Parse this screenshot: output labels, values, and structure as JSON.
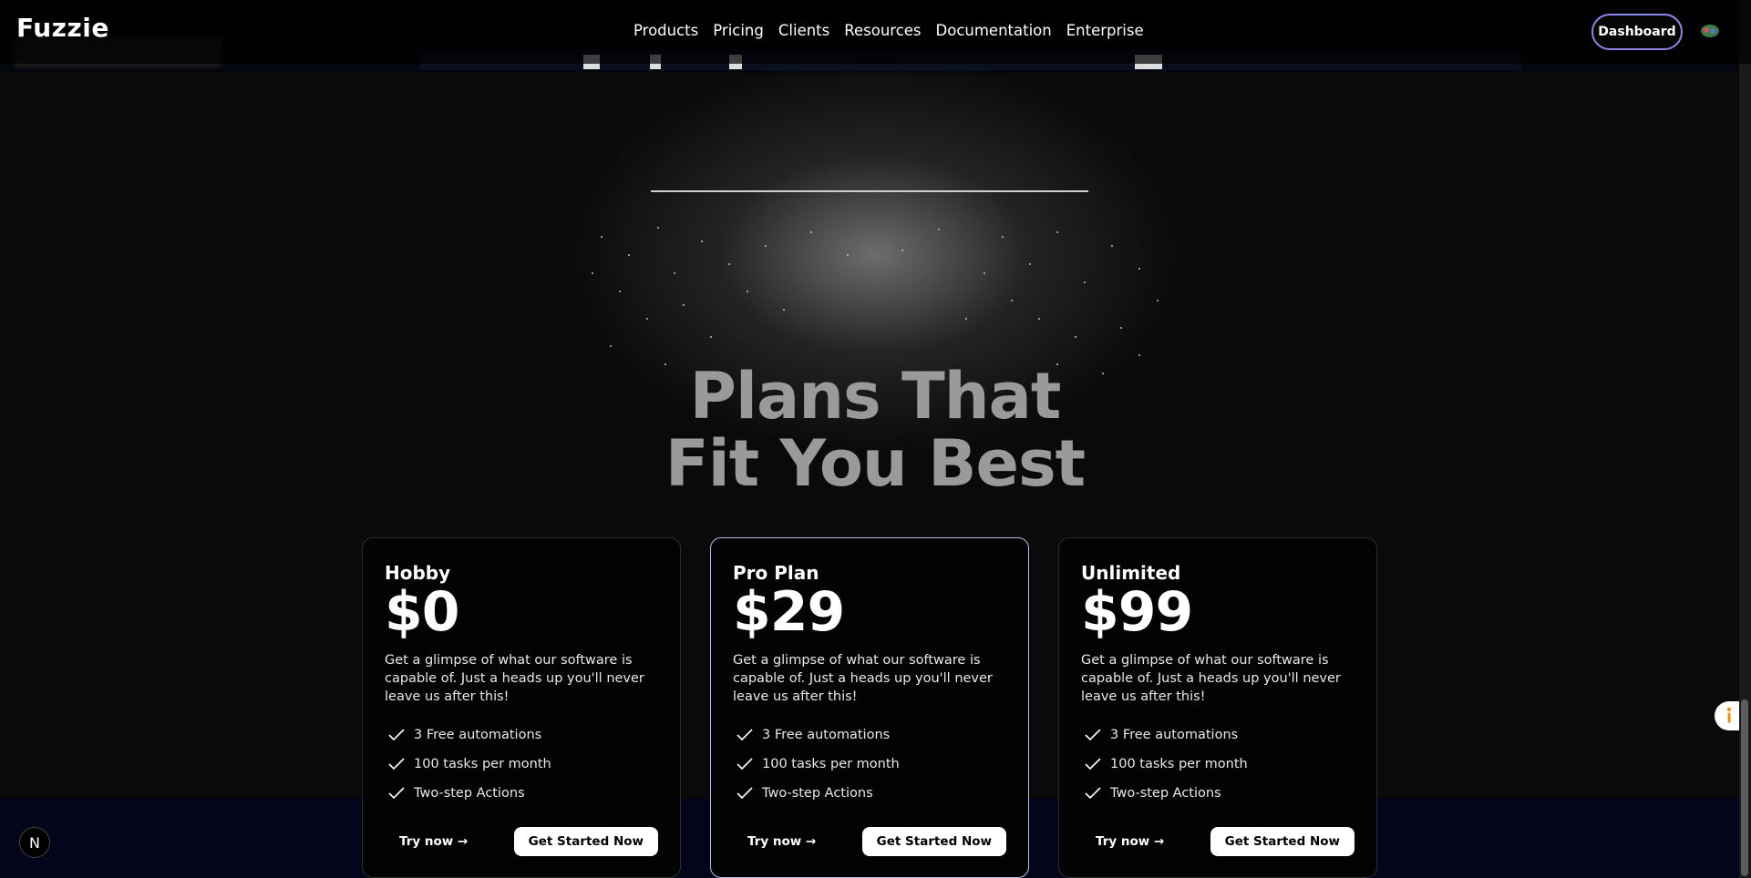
{
  "header": {
    "logo": "Fuzzie",
    "nav": [
      "Products",
      "Pricing",
      "Clients",
      "Resources",
      "Documentation",
      "Enterprise"
    ],
    "dashboard_label": "Dashboard"
  },
  "hero": {
    "title_line1": "Plans That",
    "title_line2": "Fit You Best"
  },
  "plans": [
    {
      "name": "Hobby",
      "price": "$0",
      "description": "Get a glimpse of what our software is capable of. Just a heads up you'll never leave us after this!",
      "features": [
        "3 Free automations",
        "100 tasks per month",
        "Two-step Actions"
      ],
      "try_label": "Try now →",
      "cta_label": "Get Started Now"
    },
    {
      "name": "Pro Plan",
      "price": "$29",
      "description": "Get a glimpse of what our software is capable of. Just a heads up you'll never leave us after this!",
      "features": [
        "3 Free automations",
        "100 tasks per month",
        "Two-step Actions"
      ],
      "try_label": "Try now →",
      "cta_label": "Get Started Now"
    },
    {
      "name": "Unlimited",
      "price": "$99",
      "description": "Get a glimpse of what our software is capable of. Just a heads up you'll never leave us after this!",
      "features": [
        "3 Free automations",
        "100 tasks per month",
        "Two-step Actions"
      ],
      "try_label": "Try now →",
      "cta_label": "Get Started Now"
    }
  ],
  "badge": {
    "letter": "N"
  },
  "colors": {
    "accent": "#8e86e6",
    "pro_border": "#bdb7ef",
    "background": "#0a0a0a"
  }
}
